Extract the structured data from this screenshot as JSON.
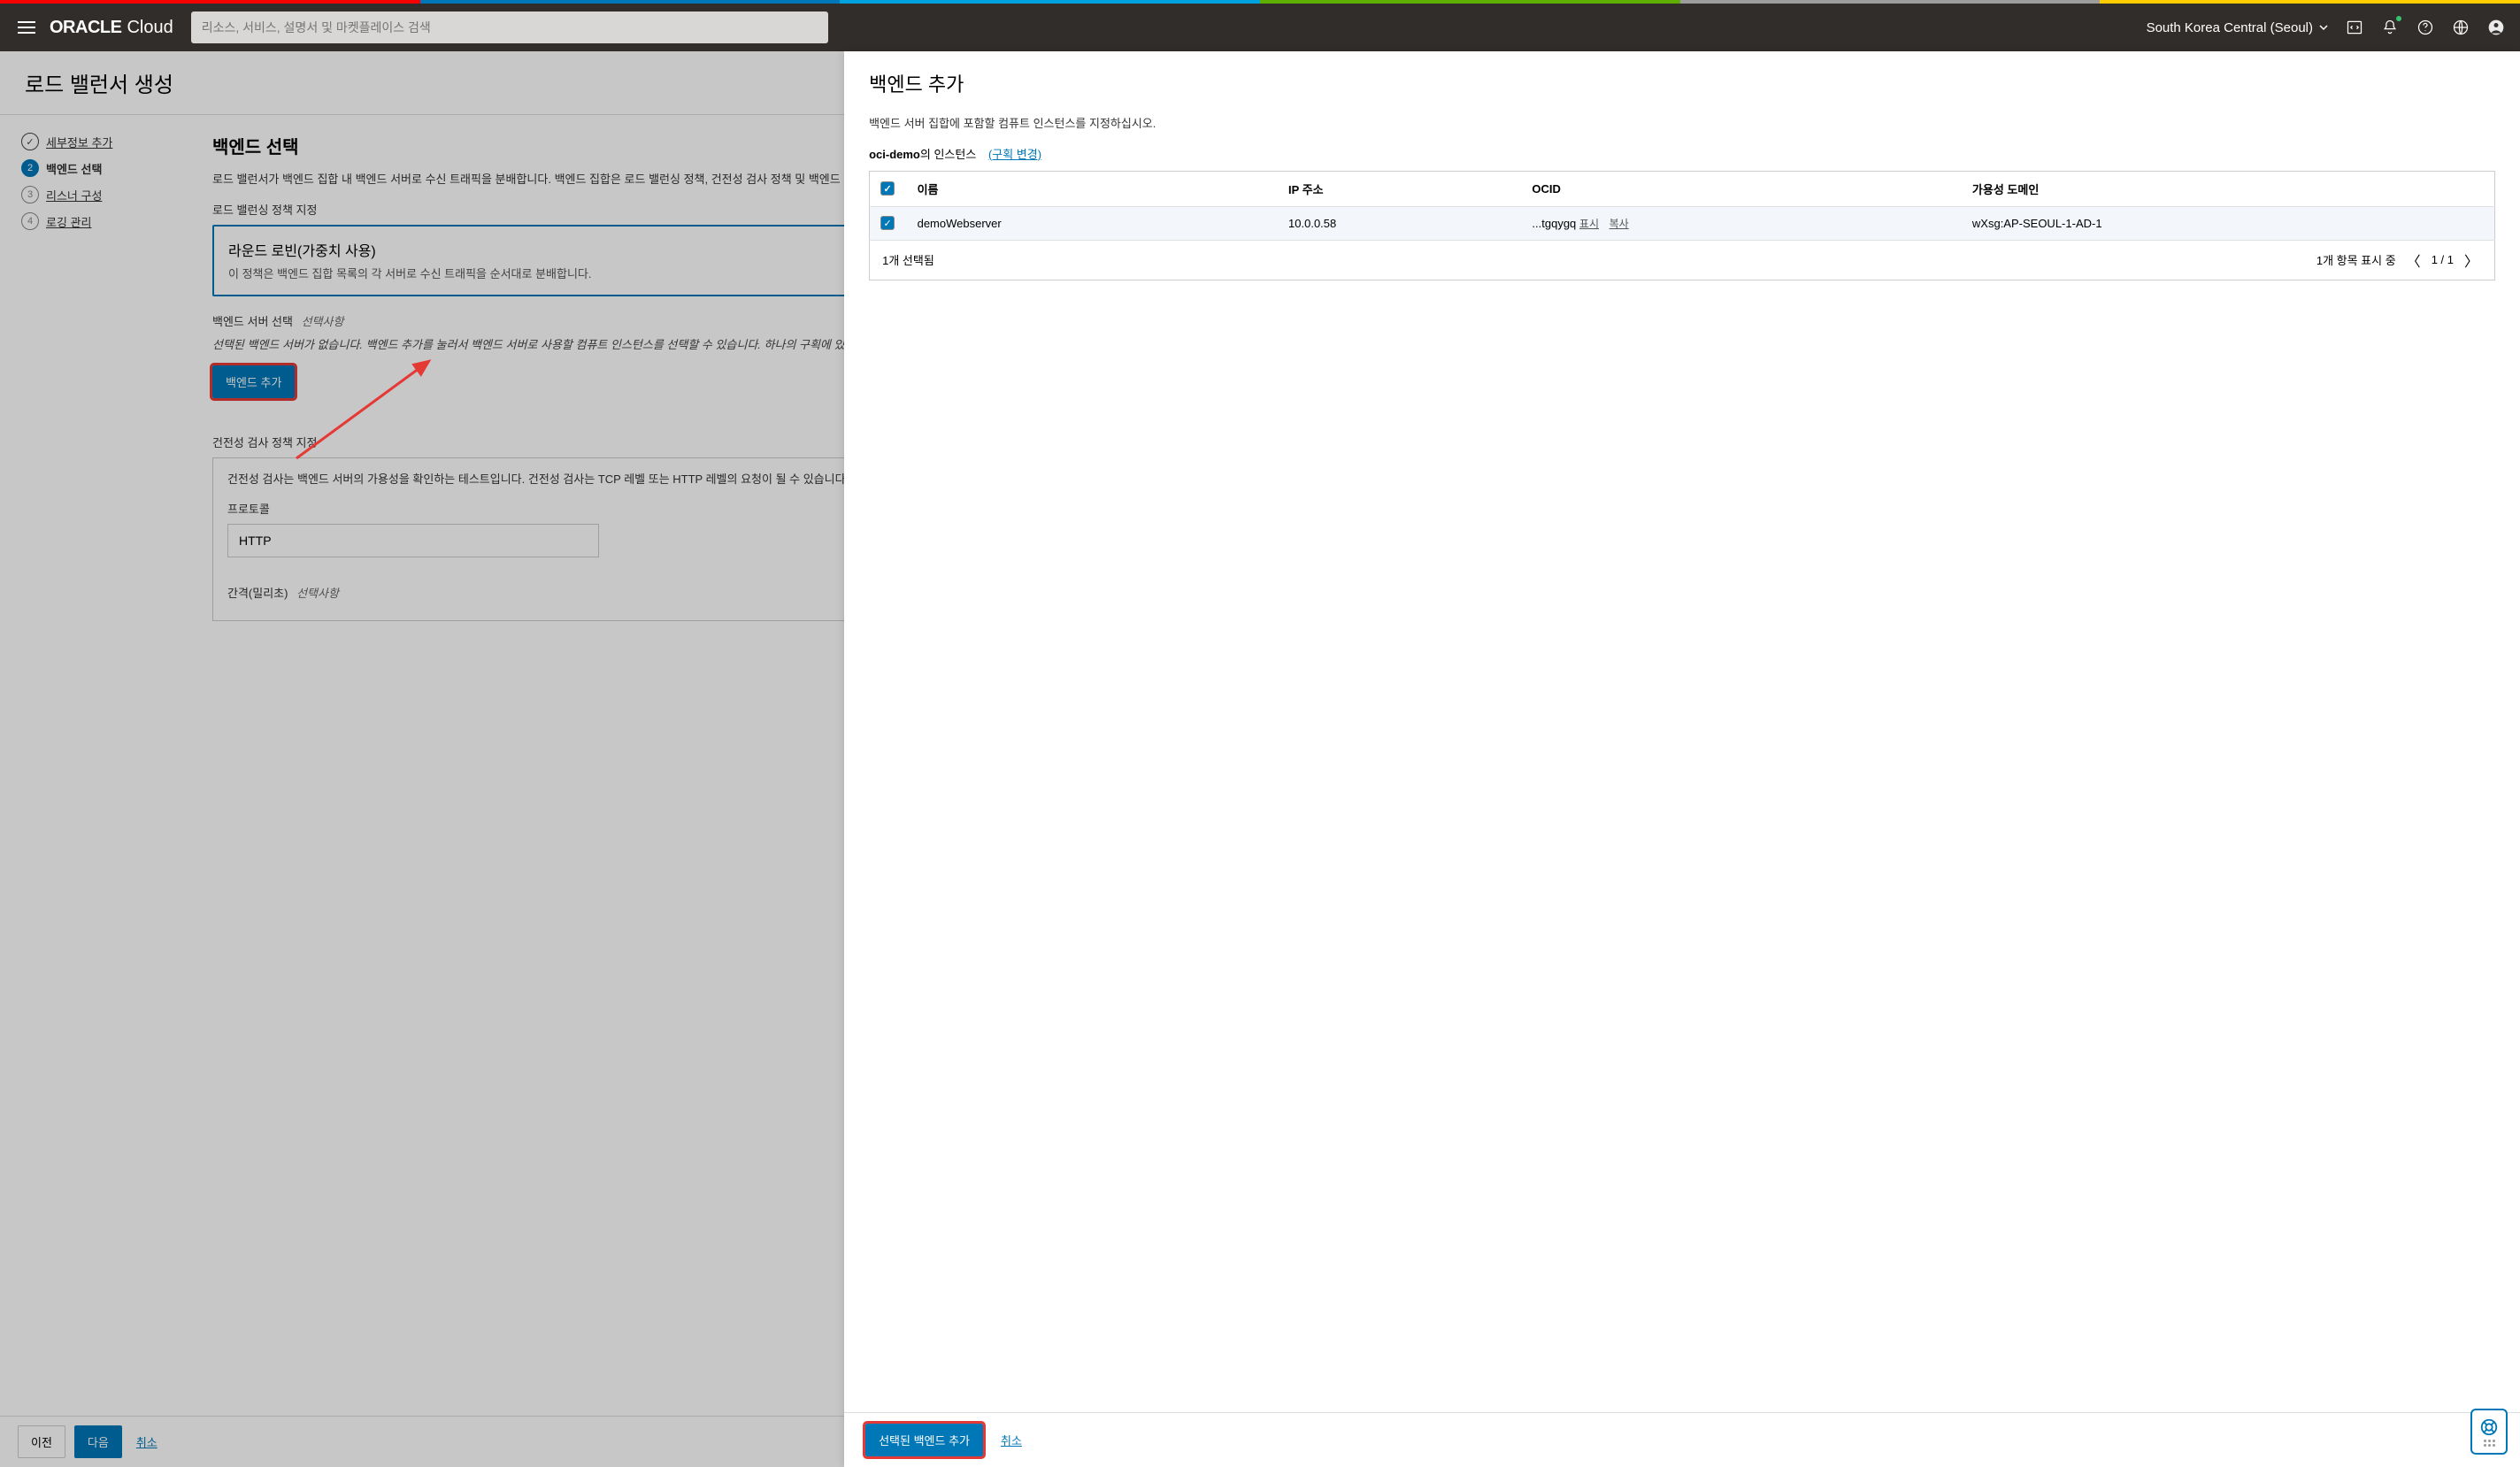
{
  "header": {
    "logo_main": "ORACLE",
    "logo_sub": "Cloud",
    "search_placeholder": "리소스, 서비스, 설명서 및 마켓플레이스 검색",
    "region": "South Korea Central (Seoul)"
  },
  "wizard": {
    "page_title": "로드 밸런서 생성",
    "steps": [
      {
        "label": "세부정보 추가",
        "state": "done"
      },
      {
        "label": "백엔드 선택",
        "state": "active"
      },
      {
        "label": "리스너 구성",
        "state": "pending"
      },
      {
        "label": "로깅 관리",
        "state": "pending"
      }
    ],
    "section_title": "백엔드 선택",
    "intro_text": "로드 밸런서가 백엔드 집합 내 백엔드 서버로 수신 트래픽을 분배합니다. 백엔드 집합은 로드 밸런싱 정책, 건전성 검사 정책 및 백엔드 서버(컴퓨트 인스턴스)으로 정의된 논리적 엔티티입니다.",
    "policy_label": "로드 밸런싱 정책 지정",
    "policy_card": {
      "title": "라운드 로빈(가중치 사용)",
      "desc": "이 정책은 백엔드 집합 목록의 각 서버로 수신 트래픽을 순서대로 분배합니다."
    },
    "backend_select_label": "백엔드 서버 선택",
    "optional_text": "선택사항",
    "backend_note": "선택된 백엔드 서버가 없습니다. 백엔드 추가를 눌러서 백엔드 서버로 사용할 컴퓨트 인스턴스를 선택할 수 있습니다. 하나의 구획에 있는 인스턴스만 한 번에 추가할 수 있습니다. 로드 밸런서를 생성한 이후 백엔드 서버를 추가할 수도 있습니다.",
    "add_backend_button": "백엔드 추가",
    "health_label": "건전성 검사 정책 지정",
    "health_desc": "건전성 검사는 백엔드 서버의 가용성을 확인하는 테스트입니다. 건전성 검사는 TCP 레벨 또는 HTTP 레벨의 요청이 될 수 있습니다. 지정한 시간 간격에 따라 로드 밸런서는 건전성 검사 정책을 적용하여 백엔드 서버를 계속 모니터링합니다.",
    "protocol_label": "프로토콜",
    "protocol_value": "HTTP",
    "interval_label": "간격(밀리초)",
    "footer": {
      "prev": "이전",
      "next": "다음",
      "cancel": "취소"
    }
  },
  "panel": {
    "title": "백엔드 추가",
    "instruction": "백엔드 서버 집합에 포함할 컴퓨트 인스턴스를 지정하십시오.",
    "compartment_prefix": "oci-demo",
    "compartment_suffix": "의 인스턴스",
    "change_link": "(구획 변경)",
    "table": {
      "headers": {
        "name": "이름",
        "ip": "IP 주소",
        "ocid": "OCID",
        "ad": "가용성 도메인"
      },
      "rows": [
        {
          "name": "demoWebserver",
          "ip": "10.0.0.58",
          "ocid": "...tgqygq",
          "show": "표시",
          "copy": "복사",
          "ad": "wXsg:AP-SEOUL-1-AD-1"
        }
      ],
      "selected_text": "1개 선택됨",
      "showing_text": "1개 항목 표시 중",
      "page_text": "1 / 1"
    },
    "footer": {
      "add_selected": "선택된 백엔드 추가",
      "cancel": "취소"
    }
  }
}
